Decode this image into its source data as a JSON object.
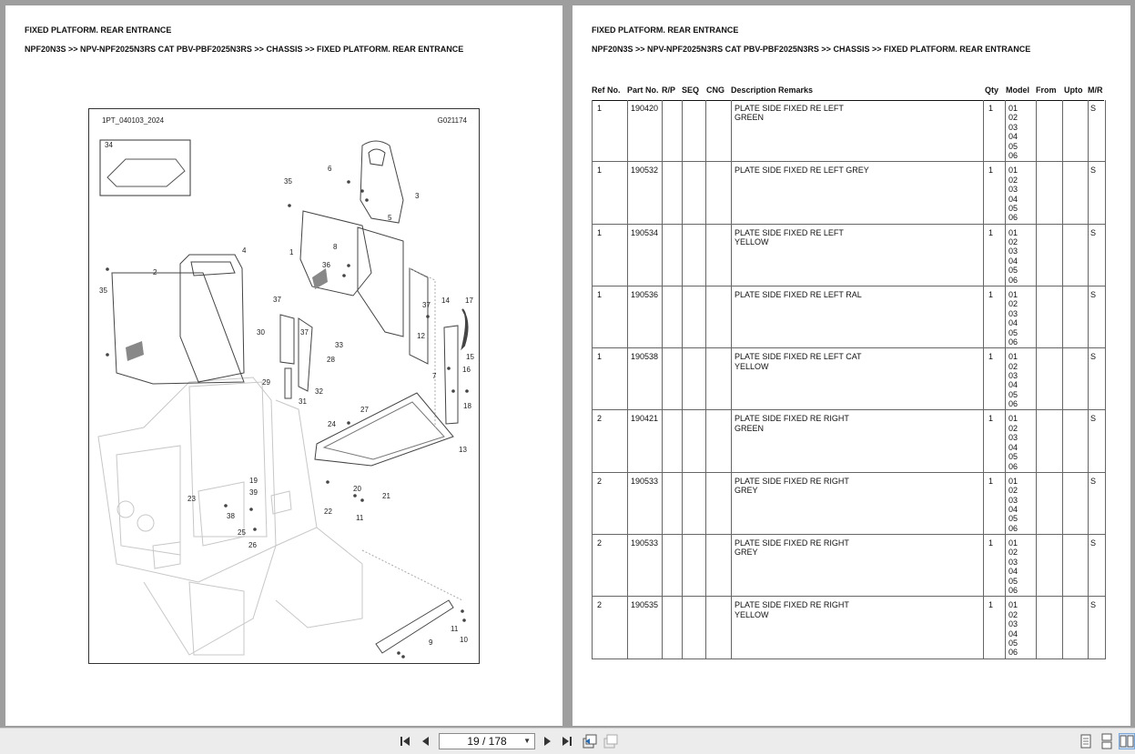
{
  "left_page": {
    "title": "FIXED PLATFORM. REAR ENTRANCE",
    "breadcrumb": "NPF20N3S >> NPV-NPF2025N3RS CAT PBV-PBF2025N3RS >> CHASSIS >> FIXED PLATFORM. REAR ENTRANCE",
    "diagram": {
      "code_left": "1PT_040103_2024",
      "code_right": "G021174",
      "callouts": [
        "34",
        "6",
        "3",
        "35",
        "5",
        "1",
        "4",
        "2",
        "8",
        "36",
        "35",
        "37",
        "30",
        "37",
        "33",
        "28",
        "14",
        "17",
        "37",
        "12",
        "15",
        "7",
        "16",
        "29",
        "32",
        "31",
        "18",
        "27",
        "24",
        "13",
        "19",
        "39",
        "20",
        "21",
        "23",
        "38",
        "22",
        "11",
        "25",
        "26",
        "11",
        "10",
        "9"
      ]
    }
  },
  "right_page": {
    "title": "FIXED PLATFORM. REAR ENTRANCE",
    "breadcrumb": "NPF20N3S >> NPV-NPF2025N3RS CAT PBV-PBF2025N3RS >> CHASSIS >> FIXED PLATFORM. REAR ENTRANCE",
    "columns": [
      "Ref No.",
      "Part No.",
      "R/P",
      "SEQ",
      "CNG",
      "Description Remarks",
      "Qty",
      "Model",
      "From",
      "Upto",
      "M/R"
    ],
    "rows": [
      {
        "ref": "1",
        "part": "190420",
        "desc": "PLATE SIDE FIXED RE LEFT\nGREEN",
        "qty": "1",
        "model": "01\n02\n03\n04\n05\n06",
        "mr": "S"
      },
      {
        "ref": "1",
        "part": "190532",
        "desc": "PLATE SIDE FIXED RE LEFT GREY",
        "qty": "1",
        "model": "01\n02\n03\n04\n05\n06",
        "mr": "S"
      },
      {
        "ref": "1",
        "part": "190534",
        "desc": "PLATE SIDE FIXED RE LEFT\nYELLOW",
        "qty": "1",
        "model": "01\n02\n03\n04\n05\n06",
        "mr": "S"
      },
      {
        "ref": "1",
        "part": "190536",
        "desc": "PLATE SIDE FIXED RE LEFT RAL",
        "qty": "1",
        "model": "01\n02\n03\n04\n05\n06",
        "mr": "S"
      },
      {
        "ref": "1",
        "part": "190538",
        "desc": "PLATE SIDE FIXED RE LEFT CAT\nYELLOW",
        "qty": "1",
        "model": "01\n02\n03\n04\n05\n06",
        "mr": "S"
      },
      {
        "ref": "2",
        "part": "190421",
        "desc": "PLATE SIDE FIXED RE RIGHT\nGREEN",
        "qty": "1",
        "model": "01\n02\n03\n04\n05\n06",
        "mr": "S"
      },
      {
        "ref": "2",
        "part": "190533",
        "desc": "PLATE SIDE FIXED RE RIGHT\nGREY",
        "qty": "1",
        "model": "01\n02\n03\n04\n05\n06",
        "mr": "S"
      },
      {
        "ref": "2",
        "part": "190533",
        "desc": "PLATE SIDE FIXED RE RIGHT\nGREY",
        "qty": "1",
        "model": "01\n02\n03\n04\n05\n06",
        "mr": "S"
      },
      {
        "ref": "2",
        "part": "190535",
        "desc": "PLATE SIDE FIXED RE RIGHT\nYELLOW",
        "qty": "1",
        "model": "01\n02\n03\n04\n05\n06",
        "mr": "S"
      }
    ]
  },
  "toolbar": {
    "page_indicator": "19 / 178",
    "icons": [
      "first-page-icon",
      "prev-page-icon",
      "next-page-icon",
      "last-page-icon",
      "previous-view-icon",
      "next-view-icon",
      "single-page-icon",
      "continuous-page-icon",
      "facing-pages-icon"
    ]
  }
}
